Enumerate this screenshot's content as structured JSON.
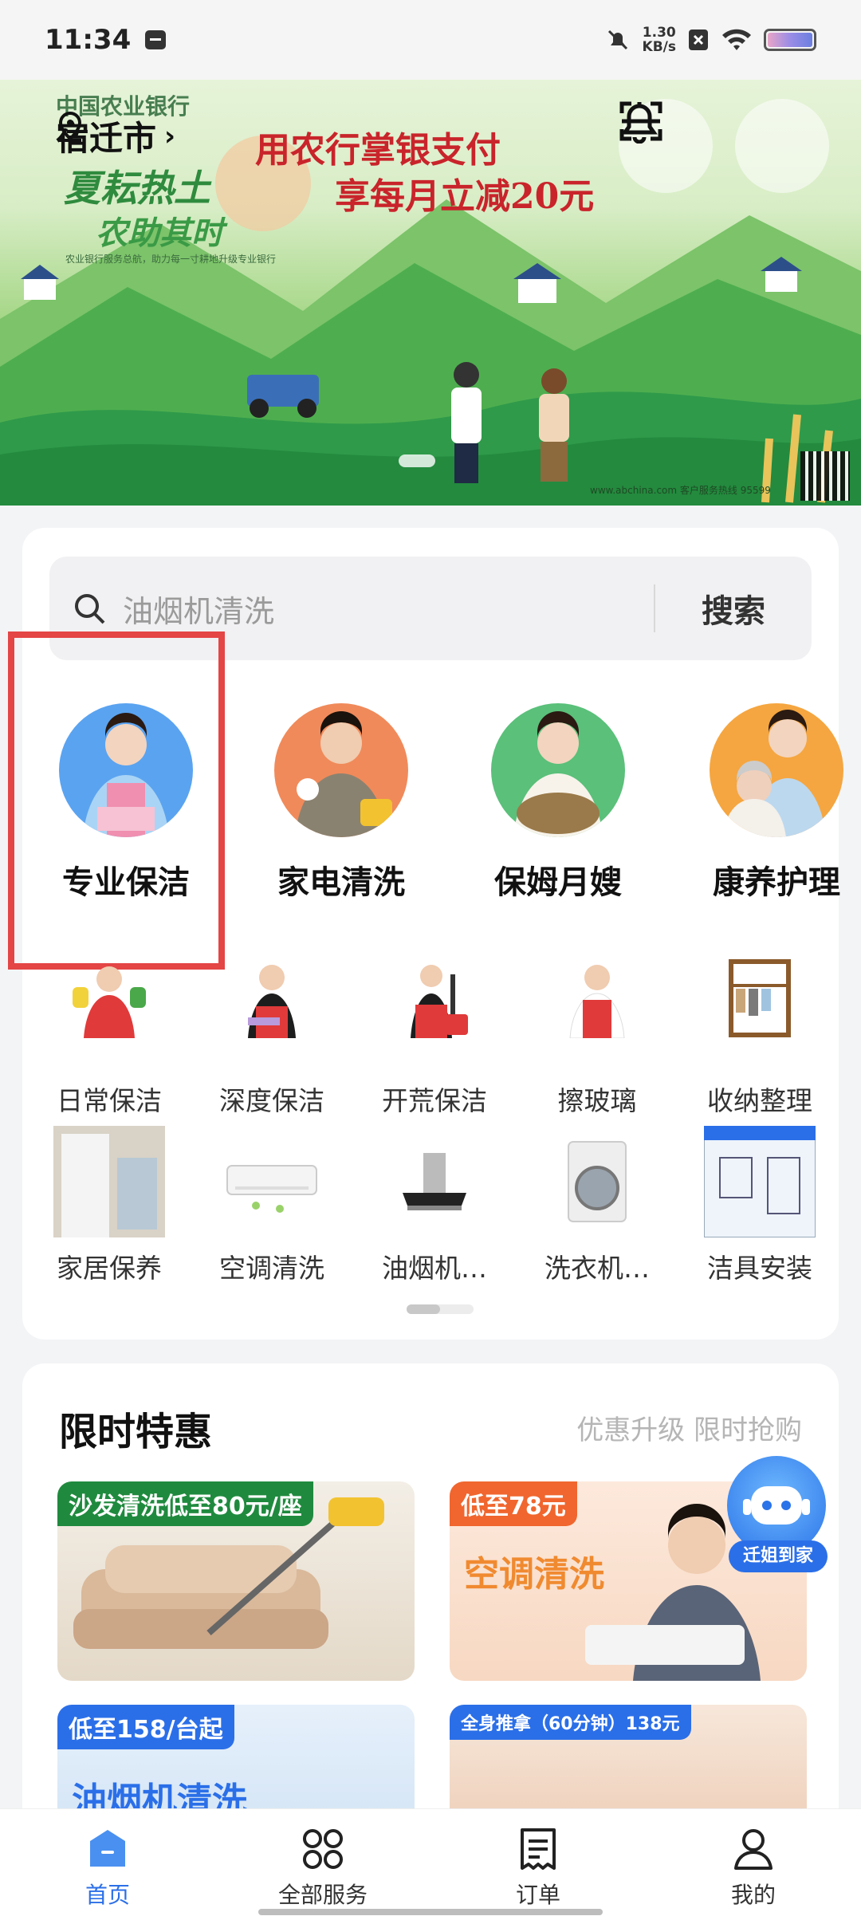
{
  "status_bar": {
    "time": "11:34",
    "net_speed_value": "1.30",
    "net_speed_unit": "KB/s",
    "icons": [
      "message-icon",
      "mute-icon",
      "sim-x-icon",
      "wifi-icon",
      "battery-icon"
    ]
  },
  "banner": {
    "location": "宿迁市",
    "bank_name": "中国农业银行",
    "promo_line1": "用农行掌银支付",
    "promo_line2": "享每月立减20元",
    "slogan1": "夏耘热土",
    "slogan2": "农助其时",
    "small_text": "农业银行服务总航，助力每一寸耕地升级专业银行",
    "url": "www.abchina.com   客户服务热线 95599",
    "icons": [
      "scan-icon",
      "bell-icon"
    ]
  },
  "search": {
    "placeholder": "油烟机清洗",
    "button_label": "搜索"
  },
  "categories": [
    {
      "label": "专业保洁",
      "color": "#5aa3f0"
    },
    {
      "label": "家电清洗",
      "color": "#f08a5a"
    },
    {
      "label": "保姆月嫂",
      "color": "#5ac07a"
    },
    {
      "label": "康养护理",
      "color": "#f5a640"
    }
  ],
  "sub_services": [
    {
      "label": "日常保洁"
    },
    {
      "label": "深度保洁"
    },
    {
      "label": "开荒保洁"
    },
    {
      "label": "擦玻璃"
    },
    {
      "label": "收纳整理"
    },
    {
      "label": "家居保养"
    },
    {
      "label": "空调清洗"
    },
    {
      "label": "油烟机…"
    },
    {
      "label": "洗衣机…"
    },
    {
      "label": "洁具安装"
    }
  ],
  "deals": {
    "title": "限时特惠",
    "subtitle": "优惠升级 限时抢购",
    "items": [
      {
        "tag": "沙发清洗低至80元/座",
        "big": "",
        "tag_color": "#1f8a3e"
      },
      {
        "tag": "低至78元",
        "big": "空调清洗",
        "tag_color": "#f0662e"
      },
      {
        "tag": "低至158/台起",
        "big": "油烟机清洗",
        "tag_color": "#2b6fe8"
      },
      {
        "tag": "全身推拿（60分钟）138元",
        "big": "",
        "tag_color": "#2b6fe8"
      }
    ]
  },
  "assistant": {
    "label": "迁姐到家"
  },
  "bottom_nav": [
    {
      "label": "首页",
      "icon": "home-icon",
      "active": true
    },
    {
      "label": "全部服务",
      "icon": "grid-icon",
      "active": false
    },
    {
      "label": "订单",
      "icon": "order-icon",
      "active": false
    },
    {
      "label": "我的",
      "icon": "profile-icon",
      "active": false
    }
  ],
  "colors": {
    "accent": "#2b6fe8",
    "highlight_border": "#e44545"
  }
}
